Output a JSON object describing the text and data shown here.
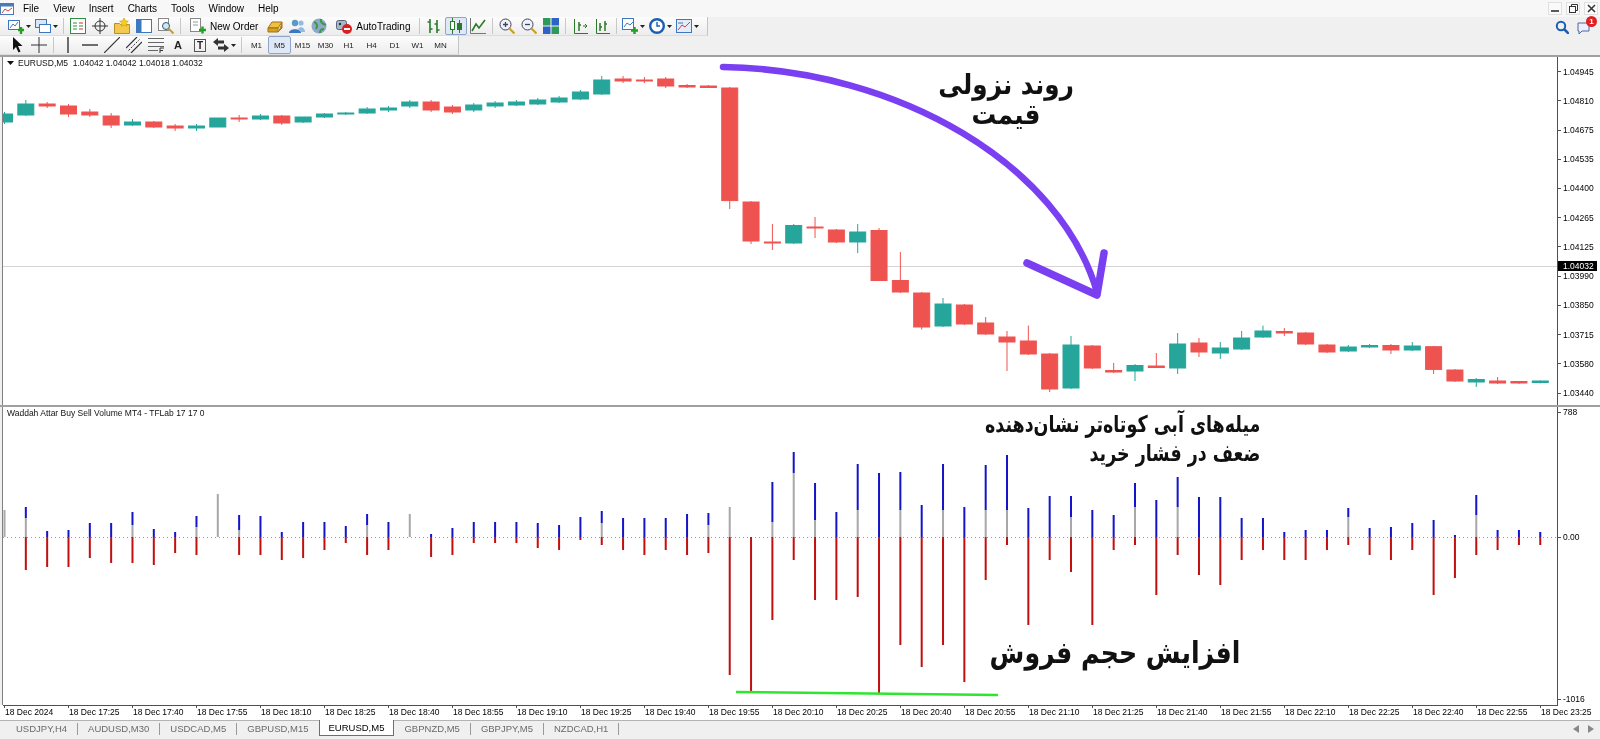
{
  "menu_bar": {
    "items": [
      "File",
      "View",
      "Insert",
      "Charts",
      "Tools",
      "Window",
      "Help"
    ]
  },
  "toolbar": {
    "new_order": "New Order",
    "auto_trading": "AutoTrading",
    "chart_types": [
      {
        "selected": false
      },
      {
        "selected": true
      },
      {
        "selected": false
      }
    ],
    "notification_count": "1"
  },
  "drawing_toolbar": {
    "text_tool": "A",
    "text_label_tool": "T",
    "periods": [
      {
        "label": "M1",
        "selected": false
      },
      {
        "label": "M5",
        "selected": true
      },
      {
        "label": "M15",
        "selected": false
      },
      {
        "label": "M30",
        "selected": false
      },
      {
        "label": "H1",
        "selected": false
      },
      {
        "label": "H4",
        "selected": false
      },
      {
        "label": "D1",
        "selected": false
      },
      {
        "label": "W1",
        "selected": false
      },
      {
        "label": "MN",
        "selected": false
      }
    ]
  },
  "price_chart": {
    "title": "EURUSD,M5  1.04042 1.04042 1.04018 1.04032",
    "price_axis": [
      "1.04945",
      "1.04810",
      "1.04675",
      "1.04535",
      "1.04400",
      "1.04265",
      "1.04125",
      "1.03990",
      "1.03850",
      "1.03715",
      "1.03580",
      "1.03440"
    ],
    "current_price": "1.04032",
    "caption": "روند نزولی\nقیمت"
  },
  "indicator": {
    "title": "Waddah Attar Buy Sell Volume MT4 - TFLab 17 17 0",
    "axis": [
      "788",
      "0.00",
      "-1016"
    ],
    "captions": [
      "میله‌های آبی کوتاه‌تر نشان‌دهنده\nضعف در فشار خرید",
      "افزایش حجم فروش"
    ]
  },
  "time_axis": [
    "18 Dec 2024",
    "18 Dec 17:25",
    "18 Dec 17:40",
    "18 Dec 17:55",
    "18 Dec 18:10",
    "18 Dec 18:25",
    "18 Dec 18:40",
    "18 Dec 18:55",
    "18 Dec 19:10",
    "18 Dec 19:25",
    "18 Dec 19:40",
    "18 Dec 19:55",
    "18 Dec 20:10",
    "18 Dec 20:25",
    "18 Dec 20:40",
    "18 Dec 20:55",
    "18 Dec 21:10",
    "18 Dec 21:25",
    "18 Dec 21:40",
    "18 Dec 21:55",
    "18 Dec 22:10",
    "18 Dec 22:25",
    "18 Dec 22:40",
    "18 Dec 22:55",
    "18 Dec 23:25"
  ],
  "tabs": [
    {
      "label": "USDJPY,H4",
      "selected": false
    },
    {
      "label": "AUDUSD,M30",
      "selected": false
    },
    {
      "label": "USDCAD,M5",
      "selected": false
    },
    {
      "label": "GBPUSD,M15",
      "selected": false
    },
    {
      "label": "EURUSD,M5",
      "selected": true
    },
    {
      "label": "GBPNZD,M5",
      "selected": false
    },
    {
      "label": "GBPJPY,M5",
      "selected": false
    },
    {
      "label": "NZDCAD,H1",
      "selected": false
    }
  ]
}
